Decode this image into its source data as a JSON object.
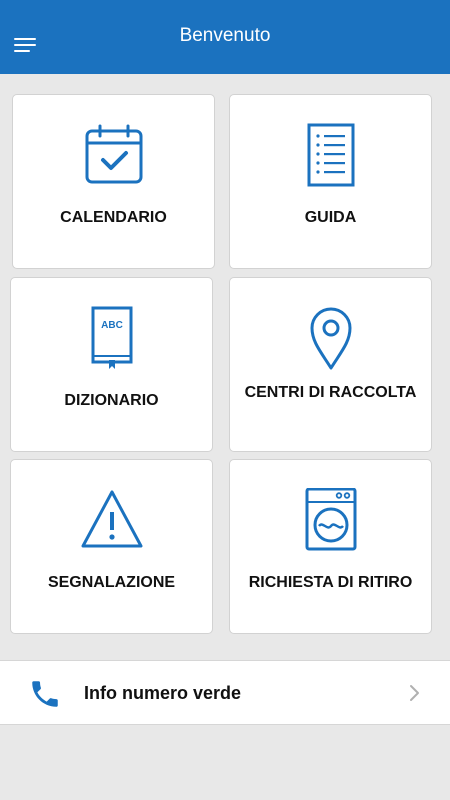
{
  "header": {
    "title": "Benvenuto"
  },
  "tiles": [
    {
      "label": "CALENDARIO",
      "icon": "calendar-check-icon"
    },
    {
      "label": "GUIDA",
      "icon": "list-document-icon"
    },
    {
      "label": "DIZIONARIO",
      "icon": "abc-book-icon",
      "book_text": "ABC"
    },
    {
      "label": "CENTRI DI RACCOLTA",
      "icon": "map-pin-icon"
    },
    {
      "label": "SEGNALAZIONE",
      "icon": "warning-triangle-icon"
    },
    {
      "label": "RICHIESTA DI RITIRO",
      "icon": "washing-machine-icon"
    }
  ],
  "info": {
    "label": "Info numero verde",
    "icon": "phone-icon"
  },
  "colors": {
    "accent": "#1b72bf",
    "background": "#e8e8e8",
    "card": "#ffffff"
  }
}
